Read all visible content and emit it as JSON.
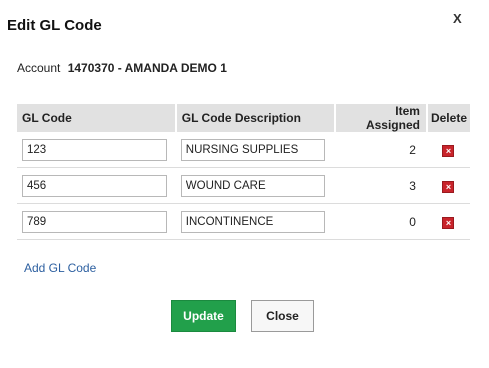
{
  "dialog": {
    "title": "Edit GL Code",
    "close_glyph": "X"
  },
  "account": {
    "label": "Account",
    "value": "1470370 - AMANDA DEMO 1"
  },
  "table": {
    "headers": {
      "gl_code": "GL Code",
      "description": "GL Code Description",
      "item_assigned": "Item Assigned",
      "delete": "Delete"
    },
    "rows": [
      {
        "gl_code": "123",
        "description": "NURSING SUPPLIES",
        "item_assigned": "2"
      },
      {
        "gl_code": "456",
        "description": "WOUND CARE",
        "item_assigned": "3"
      },
      {
        "gl_code": "789",
        "description": "INCONTINENCE",
        "item_assigned": "0"
      }
    ],
    "delete_icon": "delete-icon",
    "delete_glyph": "×"
  },
  "actions": {
    "add_label": "Add GL Code",
    "update_label": "Update",
    "close_label": "Close"
  },
  "colors": {
    "update_button": "#22a04b",
    "link": "#2c5fa0",
    "delete_icon": "#c9242b",
    "header_bg": "#e1e1e1"
  }
}
